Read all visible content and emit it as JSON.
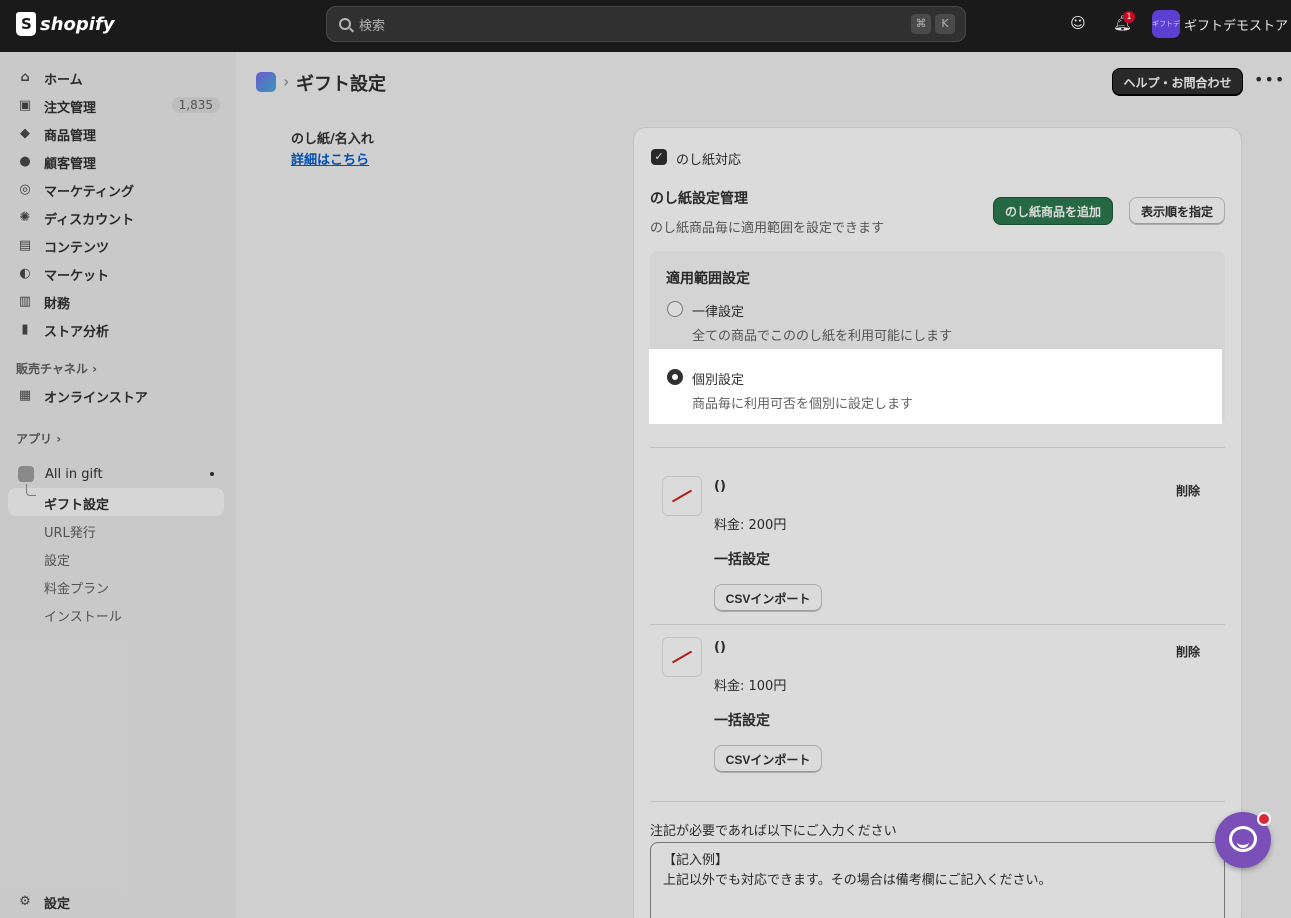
{
  "topbar": {
    "logo": "shopify",
    "search_placeholder": "検索",
    "kbd_cmd": "⌘",
    "kbd_k": "K",
    "notif_count": "1",
    "store_avatar": "ギフトデモスト",
    "store_name": "ギフトデモストア"
  },
  "sidebar": {
    "items": [
      {
        "label": "ホーム",
        "icon": "home-icon"
      },
      {
        "label": "注文管理",
        "icon": "inbox-icon",
        "badge": "1,835"
      },
      {
        "label": "商品管理",
        "icon": "tag-icon"
      },
      {
        "label": "顧客管理",
        "icon": "person-icon"
      },
      {
        "label": "マーケティング",
        "icon": "target-icon"
      },
      {
        "label": "ディスカウント",
        "icon": "discount-icon"
      },
      {
        "label": "コンテンツ",
        "icon": "content-icon"
      },
      {
        "label": "マーケット",
        "icon": "globe-icon"
      },
      {
        "label": "財務",
        "icon": "bank-icon"
      },
      {
        "label": "ストア分析",
        "icon": "chart-icon"
      }
    ],
    "sales_channel_head": "販売チャネル",
    "online_store": "オンラインストア",
    "apps_head": "アプリ",
    "app_name": "All in gift",
    "app_sub": [
      "ギフト設定",
      "URL発行",
      "設定",
      "料金プラン",
      "インストール"
    ],
    "settings": "設定"
  },
  "page": {
    "title": "ギフト設定",
    "help_button": "ヘルプ・お問合わせ",
    "more": "•••",
    "section_title": "のし紙/名入れ",
    "section_link": "詳細はこちら"
  },
  "card": {
    "checkbox_label": "のし紙対応",
    "heading": "のし紙設定管理",
    "description": "のし紙商品毎に適用範囲を設定できます",
    "add_button": "のし紙商品を追加",
    "order_button": "表示順を指定",
    "scope_title": "適用範囲設定",
    "radio1_label": "一律設定",
    "radio1_help": "全ての商品でこののし紙を利用可能にします",
    "radio2_label": "個別設定",
    "radio2_help": "商品毎に利用可否を個別に設定します",
    "products": [
      {
        "name": "()",
        "price": "料金: 200円",
        "bulk": "一括設定",
        "csv": "CSVインポート",
        "delete": "削除"
      },
      {
        "name": "()",
        "price": "料金: 100円",
        "bulk": "一括設定",
        "csv": "CSVインポート",
        "delete": "削除"
      }
    ],
    "note_label": "注記が必要であれば以下にご入力ください",
    "note_value": "【記入例】\n上記以外でも対応できます。その場合は備考欄にご記入ください。"
  }
}
